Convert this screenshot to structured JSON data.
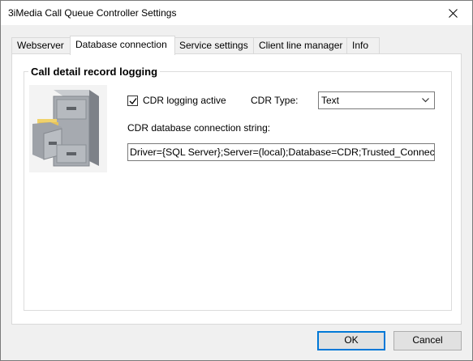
{
  "window": {
    "title": "3iMedia Call Queue Controller Settings"
  },
  "tabs": [
    {
      "label": "Webserver"
    },
    {
      "label": "Database connection",
      "active": true
    },
    {
      "label": "Service settings"
    },
    {
      "label": "Client line manager"
    },
    {
      "label": "Info"
    }
  ],
  "group": {
    "title": "Call detail record logging",
    "icon": "file-cabinet-icon",
    "cdr_logging_label": "CDR logging active",
    "cdr_logging_checked": true,
    "cdr_type_label": "CDR Type:",
    "cdr_type_value": "Text",
    "connection_label": "CDR database connection string:",
    "connection_value": "Driver={SQL Server};Server=(local);Database=CDR;Trusted_Connec"
  },
  "buttons": {
    "ok": "OK",
    "cancel": "Cancel"
  },
  "colors": {
    "accent": "#0078d7",
    "tab_border": "#d9d9d9",
    "button_bg": "#e1e1e1"
  }
}
